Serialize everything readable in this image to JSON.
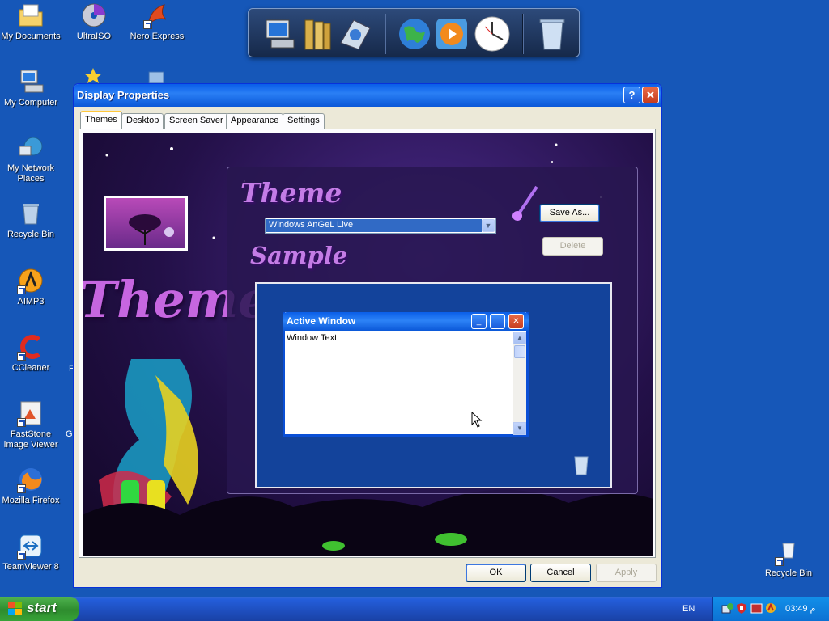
{
  "desktop": {
    "icons_left": [
      {
        "label": "My Documents"
      },
      {
        "label": "My Computer"
      },
      {
        "label": "My Network Places"
      },
      {
        "label": "Recycle Bin"
      },
      {
        "label": "AIMP3"
      },
      {
        "label": "CCleaner"
      },
      {
        "label": "FastStone Image Viewer"
      },
      {
        "label": "Mozilla Firefox"
      },
      {
        "label": "TeamViewer 8"
      }
    ],
    "icons_top": [
      {
        "label": "UltraISO"
      },
      {
        "label": "Nero Express"
      }
    ],
    "icon_right": {
      "label": "Recycle Bin"
    },
    "partial_labels": {
      "f": "F",
      "g": "G"
    }
  },
  "dock": {
    "items": [
      "my-computer-icon",
      "documents-icon",
      "control-panel-icon",
      "globe-icon",
      "media-player-icon",
      "clock-icon",
      "recycle-bin-icon"
    ]
  },
  "dialog": {
    "title": "Display Properties",
    "help_label": "?",
    "close_label": "✕",
    "tabs": [
      {
        "label": "Themes",
        "active": true
      },
      {
        "label": "Desktop"
      },
      {
        "label": "Screen Saver"
      },
      {
        "label": "Appearance"
      },
      {
        "label": "Settings"
      }
    ],
    "theme_heading": "Theme",
    "sample_heading": "Sample",
    "big_title": "Themes",
    "theme_select_value": "Windows AnGeL Live",
    "save_as_label": "Save As...",
    "delete_label": "Delete",
    "sample_window": {
      "title": "Active Window",
      "text": "Window Text"
    },
    "ok_label": "OK",
    "cancel_label": "Cancel",
    "apply_label": "Apply"
  },
  "taskbar": {
    "start_label": "start",
    "language": "EN",
    "clock": "03:49 م"
  },
  "colors": {
    "desktop_bg": "#1657b8",
    "title_blue": "#0a5ee8",
    "start_green": "#37a337",
    "theme_purple": "#c47ce6"
  }
}
